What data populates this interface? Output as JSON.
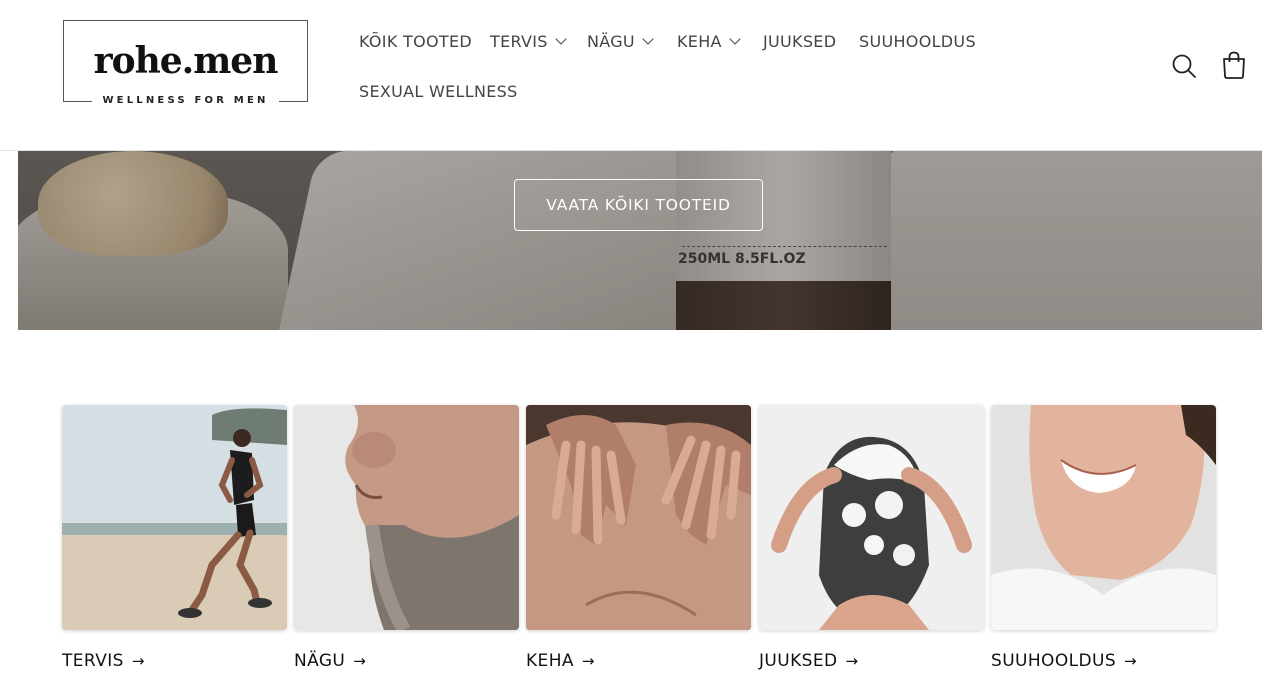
{
  "brand": {
    "name": "rohe.men",
    "tagline": "WELLNESS FOR MEN"
  },
  "nav": {
    "items": [
      {
        "label": "KÕIK TOOTED",
        "has_dropdown": false
      },
      {
        "label": "TERVIS",
        "has_dropdown": true
      },
      {
        "label": "NÄGU",
        "has_dropdown": true
      },
      {
        "label": "KEHA",
        "has_dropdown": true
      },
      {
        "label": "JUUKSED",
        "has_dropdown": false
      },
      {
        "label": "SUUHOOLDUS",
        "has_dropdown": false
      },
      {
        "label": "SEXUAL WELLNESS",
        "has_dropdown": false
      }
    ]
  },
  "header_icons": {
    "search": "search-icon",
    "cart": "cart-icon"
  },
  "hero": {
    "button_label": "VAATA KÕIKI TOOTEID",
    "bottle_label": "250ML 8.5FL.OZ"
  },
  "collections": [
    {
      "title": "TERVIS"
    },
    {
      "title": "NÄGU"
    },
    {
      "title": "KEHA"
    },
    {
      "title": "JUUKSED"
    },
    {
      "title": "SUUHOOLDUS"
    }
  ],
  "arrow_glyph": "→"
}
